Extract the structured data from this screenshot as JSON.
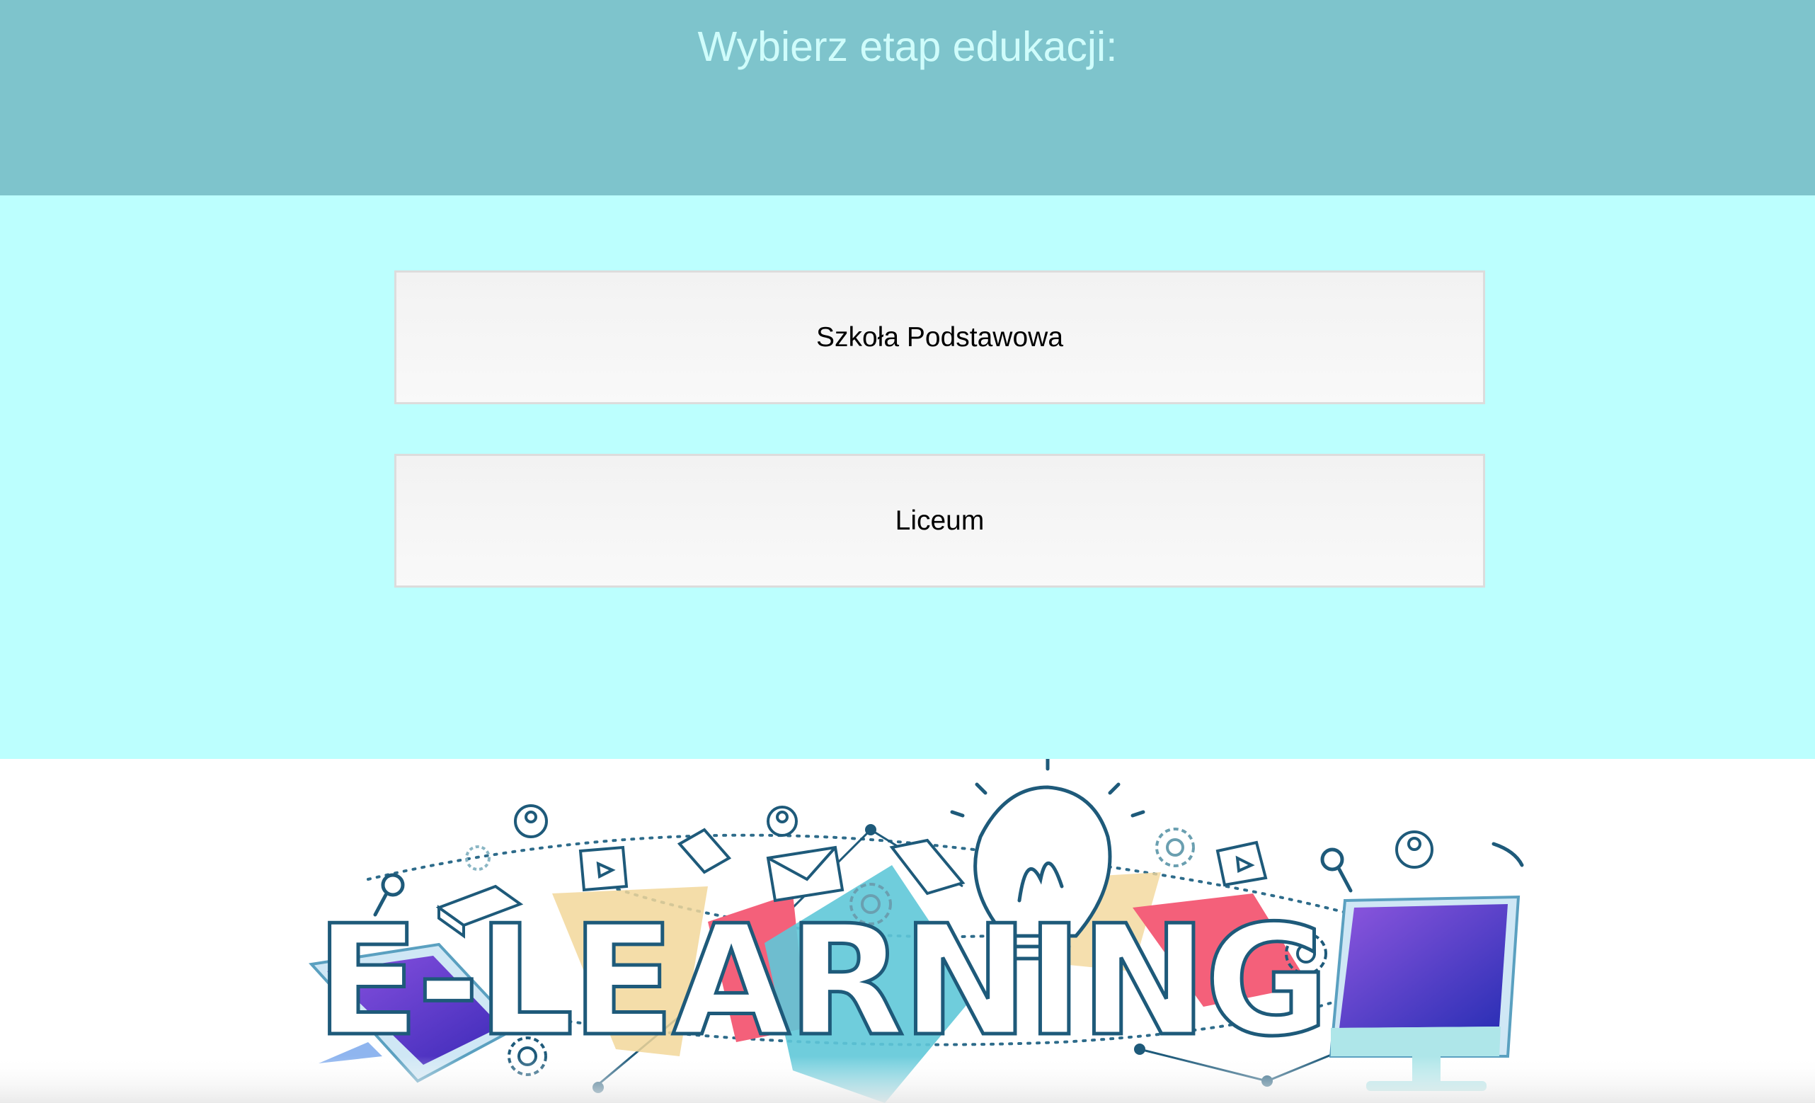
{
  "header": {
    "title": "Wybierz etap edukacji:"
  },
  "choices": [
    {
      "label": "Szkoła Podstawowa"
    },
    {
      "label": "Liceum"
    }
  ],
  "banner": {
    "wordmark": "E-LEARNING"
  },
  "colors": {
    "header_bg": "#7ec4cc",
    "header_text": "#cffcfb",
    "main_bg": "#bcfffe",
    "button_bg": "#f4f4f4",
    "button_border": "#dcdcdc",
    "purple": "#6a3fd0",
    "teal": "#5fc8d8",
    "pink": "#f4607a",
    "sand": "#f2d79a",
    "navy": "#1e5a7a"
  },
  "icons": [
    "tablet-icon",
    "monitor-icon",
    "lightbulb-icon",
    "envelope-icon",
    "book-icon",
    "gear-icon",
    "user-icon",
    "magnifier-icon",
    "play-icon"
  ]
}
